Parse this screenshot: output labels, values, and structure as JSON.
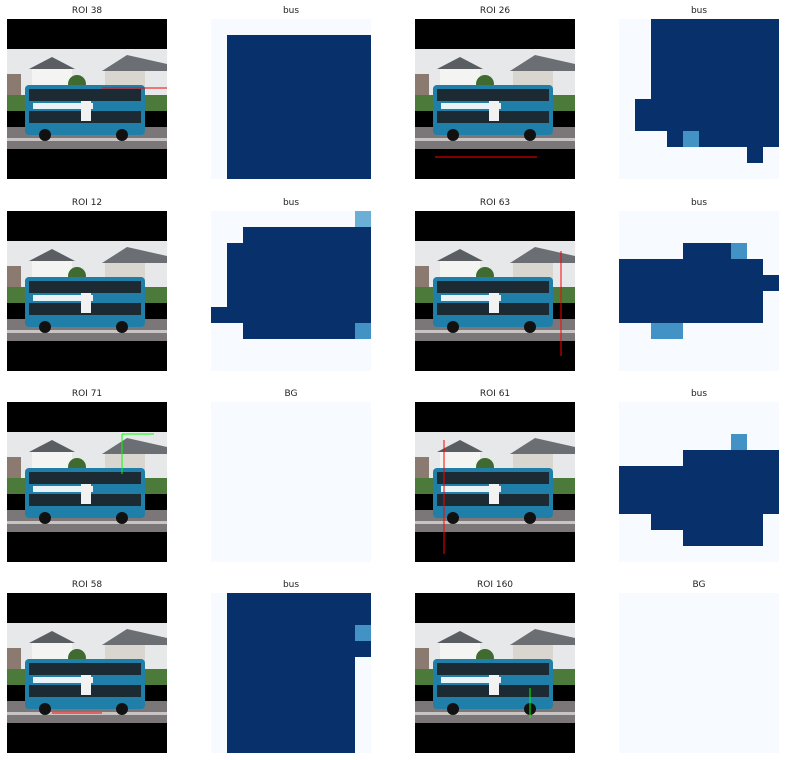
{
  "figure": {
    "colors": {
      "mask_fg": "#08306b",
      "mask_bg": "#f7fbff",
      "mask_mid": "#4292c6",
      "mask_light": "#6baed6",
      "letterbox": "#000000",
      "bus_body": "#1f7fa8",
      "roi_red": "#ff0000",
      "roi_green": "#00ff00"
    },
    "rows": [
      {
        "roi": {
          "title": "ROI 38"
        },
        "mask": {
          "title": "bus",
          "cells": [
            "0000000000",
            "0111111111",
            "0111111111",
            "0111111111",
            "0111111111",
            "0111111111",
            "0111111111",
            "0111111111",
            "0111111111",
            "0111111111"
          ]
        }
      },
      {
        "roi": {
          "title": "ROI 26"
        },
        "mask": {
          "title": "bus",
          "cells": [
            "0011111111",
            "0011111111",
            "0011111111",
            "0011111111",
            "0011111111",
            "0111111111",
            "0111111111",
            "0001211111",
            "0000000010",
            "0000000000"
          ]
        }
      },
      {
        "roi": {
          "title": "ROI 12"
        },
        "mask": {
          "title": "bus",
          "cells": [
            "0000000003",
            "0011111111",
            "0111111111",
            "0111111111",
            "0111111111",
            "0111111111",
            "1111111111",
            "0011111112",
            "0000000000",
            "0000000000"
          ]
        }
      },
      {
        "roi": {
          "title": "ROI 63"
        },
        "mask": {
          "title": "bus",
          "cells": [
            "0000000000",
            "0000000000",
            "0000111200",
            "1111111110",
            "1111111111",
            "1111111110",
            "1111111110",
            "0022000000",
            "0000000000",
            "0000000000"
          ]
        }
      },
      {
        "roi": {
          "title": "ROI 71"
        },
        "mask": {
          "title": "BG",
          "cells": [
            "0000000000",
            "0000000000",
            "0000000000",
            "0000000000",
            "0000000000",
            "0000000000",
            "0000000000",
            "0000000000",
            "0000000000",
            "0000000000"
          ]
        }
      },
      {
        "roi": {
          "title": "ROI 61"
        },
        "mask": {
          "title": "bus",
          "cells": [
            "0000000000",
            "0000000000",
            "0000000200",
            "0000111111",
            "1111111111",
            "1111111111",
            "1111111111",
            "0011111110",
            "0000111110",
            "0000000000"
          ]
        }
      },
      {
        "roi": {
          "title": "ROI 58"
        },
        "mask": {
          "title": "bus",
          "cells": [
            "0111111111",
            "0111111111",
            "0111111112",
            "0111111111",
            "0111111110",
            "0111111110",
            "0111111110",
            "0111111110",
            "0111111110",
            "0111111110"
          ]
        }
      },
      {
        "roi": {
          "title": "ROI 160"
        },
        "mask": {
          "title": "BG",
          "cells": [
            "0000000000",
            "0000000000",
            "0000000000",
            "0000000000",
            "0000000000",
            "0000000000",
            "0000000000",
            "0000000000",
            "0000000000",
            "0000000000"
          ]
        }
      }
    ]
  }
}
